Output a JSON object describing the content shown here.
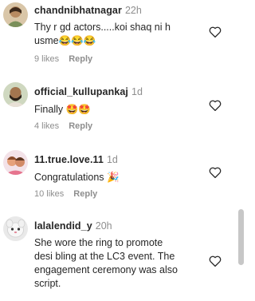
{
  "comments": [
    {
      "username": "chandnibhatnagar",
      "time": "22h",
      "text_line1": "Thy r gd actors.....koi shaq ni h",
      "text_line2": "usme😂😂😂",
      "likes": "9 likes",
      "reply": "Reply"
    },
    {
      "username": "official_kullupankaj",
      "time": "1d",
      "text_line1": "Finally 🤩🤩",
      "likes": "4 likes",
      "reply": "Reply"
    },
    {
      "username": "11.true.love.11",
      "time": "1d",
      "text_line1": "Congratulations 🎉",
      "likes": "10 likes",
      "reply": "Reply"
    },
    {
      "username": "lalalendid_y",
      "time": "20h",
      "text_lines": [
        "She wore the ring to promote",
        "desi bling at the LC3 event. The",
        "engagement ceremony was also",
        "script."
      ]
    }
  ],
  "icons": {
    "like": "heart-outline-icon"
  },
  "colors": {
    "muted": "#8e8e8e",
    "text": "#262626"
  }
}
